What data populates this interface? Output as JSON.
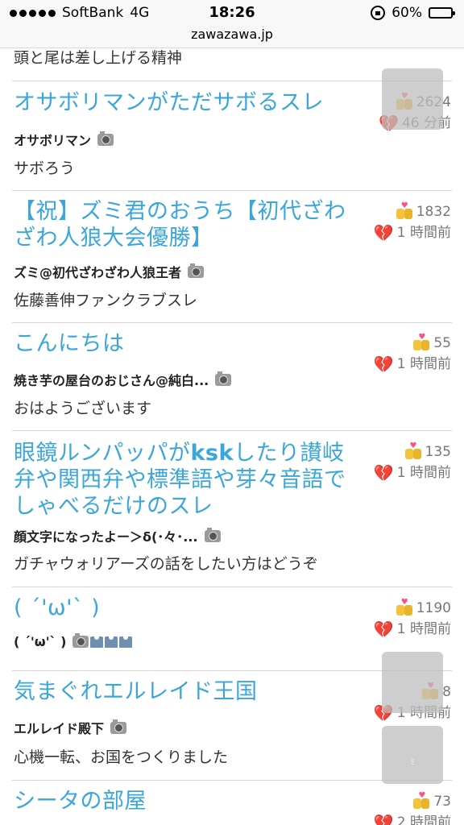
{
  "status_bar": {
    "carrier": "SoftBank",
    "network": "4G",
    "time": "18:26",
    "battery": "60%",
    "battery_level": 0.6,
    "url": "zawazawa.jp"
  },
  "partial_text": "頭と尾は差し上げる精神",
  "threads": [
    {
      "title": "オサボリマンがただサボるスレ",
      "likes": "2624",
      "updated": "46 分前",
      "author": "オサボリマン",
      "description": "サボろう"
    },
    {
      "title": "【祝】ズミ君のおうち【初代ざわざわ人狼大会優勝】",
      "likes": "1832",
      "updated": "1 時間前",
      "author": "ズミ@初代ざわざわ人狼王者",
      "description": "佐藤善伸ファンクラブスレ"
    },
    {
      "title": "こんにちは",
      "likes": "55",
      "updated": "1 時間前",
      "author": "焼き芋の屋台のおじさん@純白...",
      "description": "おはようございます"
    },
    {
      "title_parts": [
        "眼鏡ルンパッパが",
        "ksk",
        "したり讃岐弁や関西弁や標準語や芽々音語でしゃべるだけのスレ"
      ],
      "likes": "135",
      "updated": "1 時間前",
      "author": "顔文字になったよー＞δ(･々･...",
      "description": "ガチャウォリアーズの話をしたい方はどうぞ"
    },
    {
      "title": "( ´'ω'` )",
      "likes": "1190",
      "updated": "1 時間前",
      "author": "( ´'ω'` )",
      "description": ""
    },
    {
      "title": "気まぐれエルレイド王国",
      "likes": "8",
      "updated": "1 時間前",
      "author": "エルレイド殿下",
      "description": "心機一転、お国をつくりました"
    },
    {
      "title": "シータの部屋",
      "likes": "73",
      "updated": "2 時間前",
      "author": "",
      "description": ""
    }
  ],
  "icons": {
    "likes": "heart-couple-icon",
    "updated": "broken-heart-icon",
    "author_photo": "camera-icon",
    "shirt": "shirt-icon",
    "overlay_icon_text": "ﾐ"
  },
  "colors": {
    "title": "#3aa6d9",
    "broken_heart": "#c8102e"
  }
}
